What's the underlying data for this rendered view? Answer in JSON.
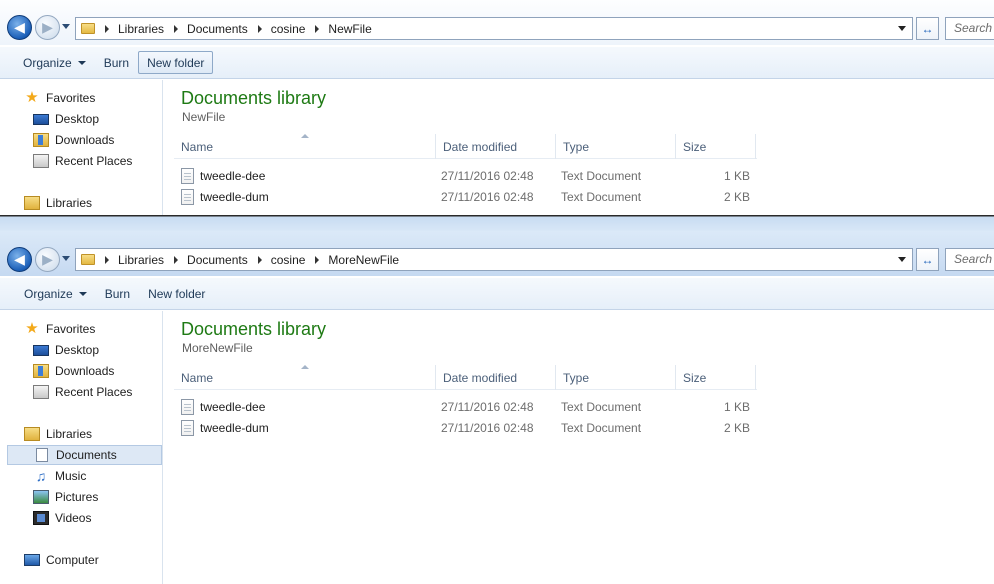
{
  "windows": [
    {
      "back_icon": "back-arrow-icon",
      "forward_icon": "forward-arrow-icon",
      "breadcrumb": [
        "Libraries",
        "Documents",
        "cosine",
        "NewFile"
      ],
      "refresh_glyph": "↔",
      "search_placeholder": "Search",
      "toolbar": {
        "organize": "Organize",
        "burn": "Burn",
        "new_folder": "New folder"
      },
      "nav": {
        "favorites": "Favorites",
        "desktop": "Desktop",
        "downloads": "Downloads",
        "recent_places": "Recent Places",
        "libraries": "Libraries"
      },
      "library_title": "Documents library",
      "library_subtitle": "NewFile",
      "columns": {
        "name": "Name",
        "date": "Date modified",
        "type": "Type",
        "size": "Size"
      },
      "files": [
        {
          "name": "tweedle-dee",
          "date": "27/11/2016 02:48",
          "type": "Text Document",
          "size": "1 KB"
        },
        {
          "name": "tweedle-dum",
          "date": "27/11/2016 02:48",
          "type": "Text Document",
          "size": "2 KB"
        }
      ]
    },
    {
      "back_icon": "back-arrow-icon",
      "forward_icon": "forward-arrow-icon",
      "breadcrumb": [
        "Libraries",
        "Documents",
        "cosine",
        "MoreNewFile"
      ],
      "refresh_glyph": "↔",
      "search_placeholder": "Search",
      "toolbar": {
        "organize": "Organize",
        "burn": "Burn",
        "new_folder": "New folder"
      },
      "nav": {
        "favorites": "Favorites",
        "desktop": "Desktop",
        "downloads": "Downloads",
        "recent_places": "Recent Places",
        "libraries": "Libraries",
        "documents": "Documents",
        "music": "Music",
        "pictures": "Pictures",
        "videos": "Videos",
        "computer": "Computer"
      },
      "library_title": "Documents library",
      "library_subtitle": "MoreNewFile",
      "columns": {
        "name": "Name",
        "date": "Date modified",
        "type": "Type",
        "size": "Size"
      },
      "files": [
        {
          "name": "tweedle-dee",
          "date": "27/11/2016 02:48",
          "type": "Text Document",
          "size": "1 KB"
        },
        {
          "name": "tweedle-dum",
          "date": "27/11/2016 02:48",
          "type": "Text Document",
          "size": "2 KB"
        }
      ]
    }
  ]
}
